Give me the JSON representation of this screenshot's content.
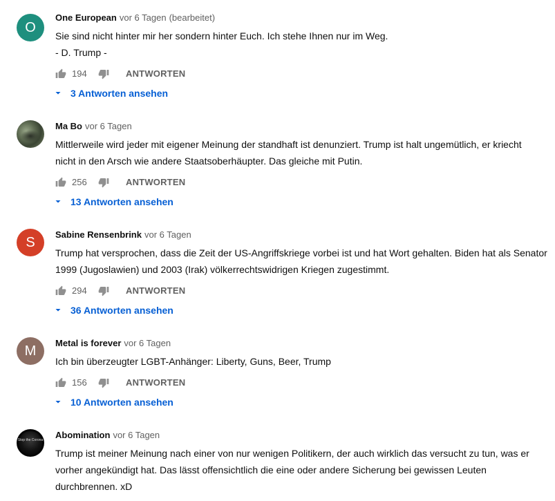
{
  "comments": [
    {
      "author": "One European",
      "time": "vor 6 Tagen",
      "edited": "(bearbeitet)",
      "avatar": {
        "letter": "O",
        "color": "#1e8f7e"
      },
      "lines": [
        "Sie sind nicht hinter mir her sondern hinter Euch. Ich stehe Ihnen nur im Weg.",
        "- D. Trump -"
      ],
      "likes": "194",
      "reply_label": "ANTWORTEN",
      "replies_label": "3 Antworten ansehen"
    },
    {
      "author": "Ma Bo",
      "time": "vor 6 Tagen",
      "avatar": {
        "type": "photo"
      },
      "lines": [
        "Mittlerweile wird jeder mit eigener Meinung der standhaft ist denunziert. Trump ist halt ungemütlich, er kriecht",
        "nicht in den Arsch wie andere Staatsoberhäupter. Das gleiche mit Putin."
      ],
      "likes": "256",
      "reply_label": "ANTWORTEN",
      "replies_label": "13 Antworten ansehen"
    },
    {
      "author": "Sabine Rensenbrink",
      "time": "vor 6 Tagen",
      "avatar": {
        "letter": "S",
        "color": "#d43f27"
      },
      "lines": [
        "Trump hat versprochen, dass die Zeit der US-Angriffskriege vorbei ist und hat Wort gehalten. Biden hat als Senator",
        "1999 (Jugoslawien) und 2003 (Irak) völkerrechtswidrigen Kriegen zugestimmt."
      ],
      "likes": "294",
      "reply_label": "ANTWORTEN",
      "replies_label": "36 Antworten ansehen"
    },
    {
      "author": "Metal is forever",
      "time": "vor 6 Tagen",
      "avatar": {
        "letter": "M",
        "color": "#8d6e63"
      },
      "lines": [
        "Ich bin überzeugter LGBT-Anhänger: Liberty, Guns, Beer, Trump"
      ],
      "likes": "156",
      "reply_label": "ANTWORTEN",
      "replies_label": "10 Antworten ansehen"
    },
    {
      "author": "Abomination",
      "time": "vor 6 Tagen",
      "avatar": {
        "type": "dark",
        "text": "Stop the Corona"
      },
      "lines": [
        "Trump ist meiner Meinung nach einer von nur wenigen Politikern, der auch wirklich das versucht zu tun, was er",
        "vorher angekündigt hat. Das lässt offensichtlich die eine oder andere Sicherung bei gewissen Leuten",
        "durchbrennen. xD"
      ]
    }
  ],
  "icons": {
    "like": "thumb-up-icon",
    "dislike": "thumb-down-icon",
    "expand": "chevron-down-icon"
  }
}
